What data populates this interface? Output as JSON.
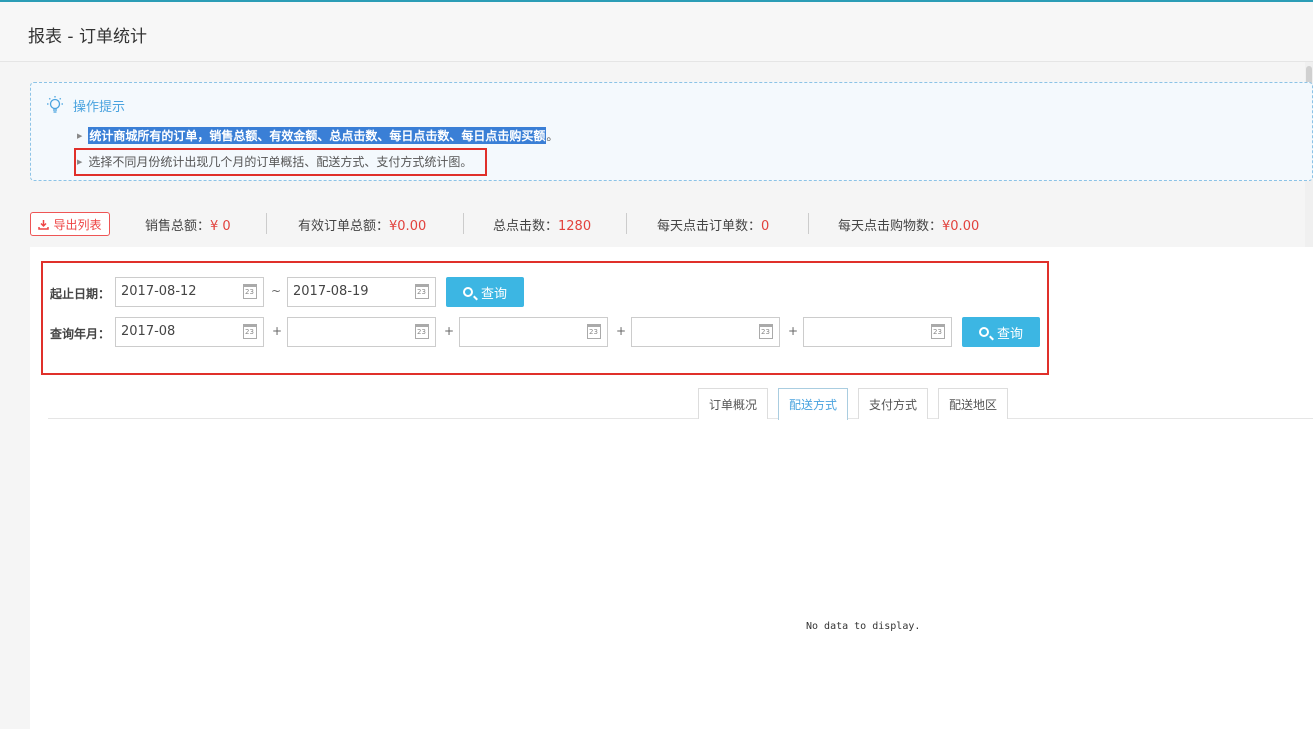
{
  "header": {
    "title": "报表 - 订单统计"
  },
  "tips": {
    "title": "操作提示",
    "items": [
      "统计商城所有的订单，销售总额、有效金额、总点击数、每日点击数、每日点击购买额",
      "选择不同月份统计出现几个月的订单概括、配送方式、支付方式统计图。"
    ],
    "item1_suffix": "。"
  },
  "stats": {
    "export_label": "导出列表",
    "items": [
      {
        "label": "销售总额：",
        "value": "¥ 0"
      },
      {
        "label": "有效订单总额：",
        "value": "¥0.00"
      },
      {
        "label": "总点击数：",
        "value": "1280"
      },
      {
        "label": "每天点击订单数：",
        "value": "0"
      },
      {
        "label": "每天点击购物数：",
        "value": "¥0.00"
      }
    ]
  },
  "filter": {
    "date_range_label": "起止日期：",
    "start_date": "2017-08-12",
    "range_sep": "~",
    "end_date": "2017-08-19",
    "month_label": "查询年月：",
    "months": [
      "2017-08",
      "",
      "",
      "",
      ""
    ],
    "plus": "+",
    "query_label": "查询",
    "calendar_day": "23"
  },
  "tabs": [
    {
      "label": "订单概况",
      "active": false
    },
    {
      "label": "配送方式",
      "active": true
    },
    {
      "label": "支付方式",
      "active": false
    },
    {
      "label": "配送地区",
      "active": false
    }
  ],
  "chart": {
    "empty_text": "No data to display."
  },
  "colors": {
    "accent": "#3cb6e3",
    "value_red": "#e2423d",
    "tip_blue": "#4aa3df",
    "highlight_box": "#e0302a"
  }
}
